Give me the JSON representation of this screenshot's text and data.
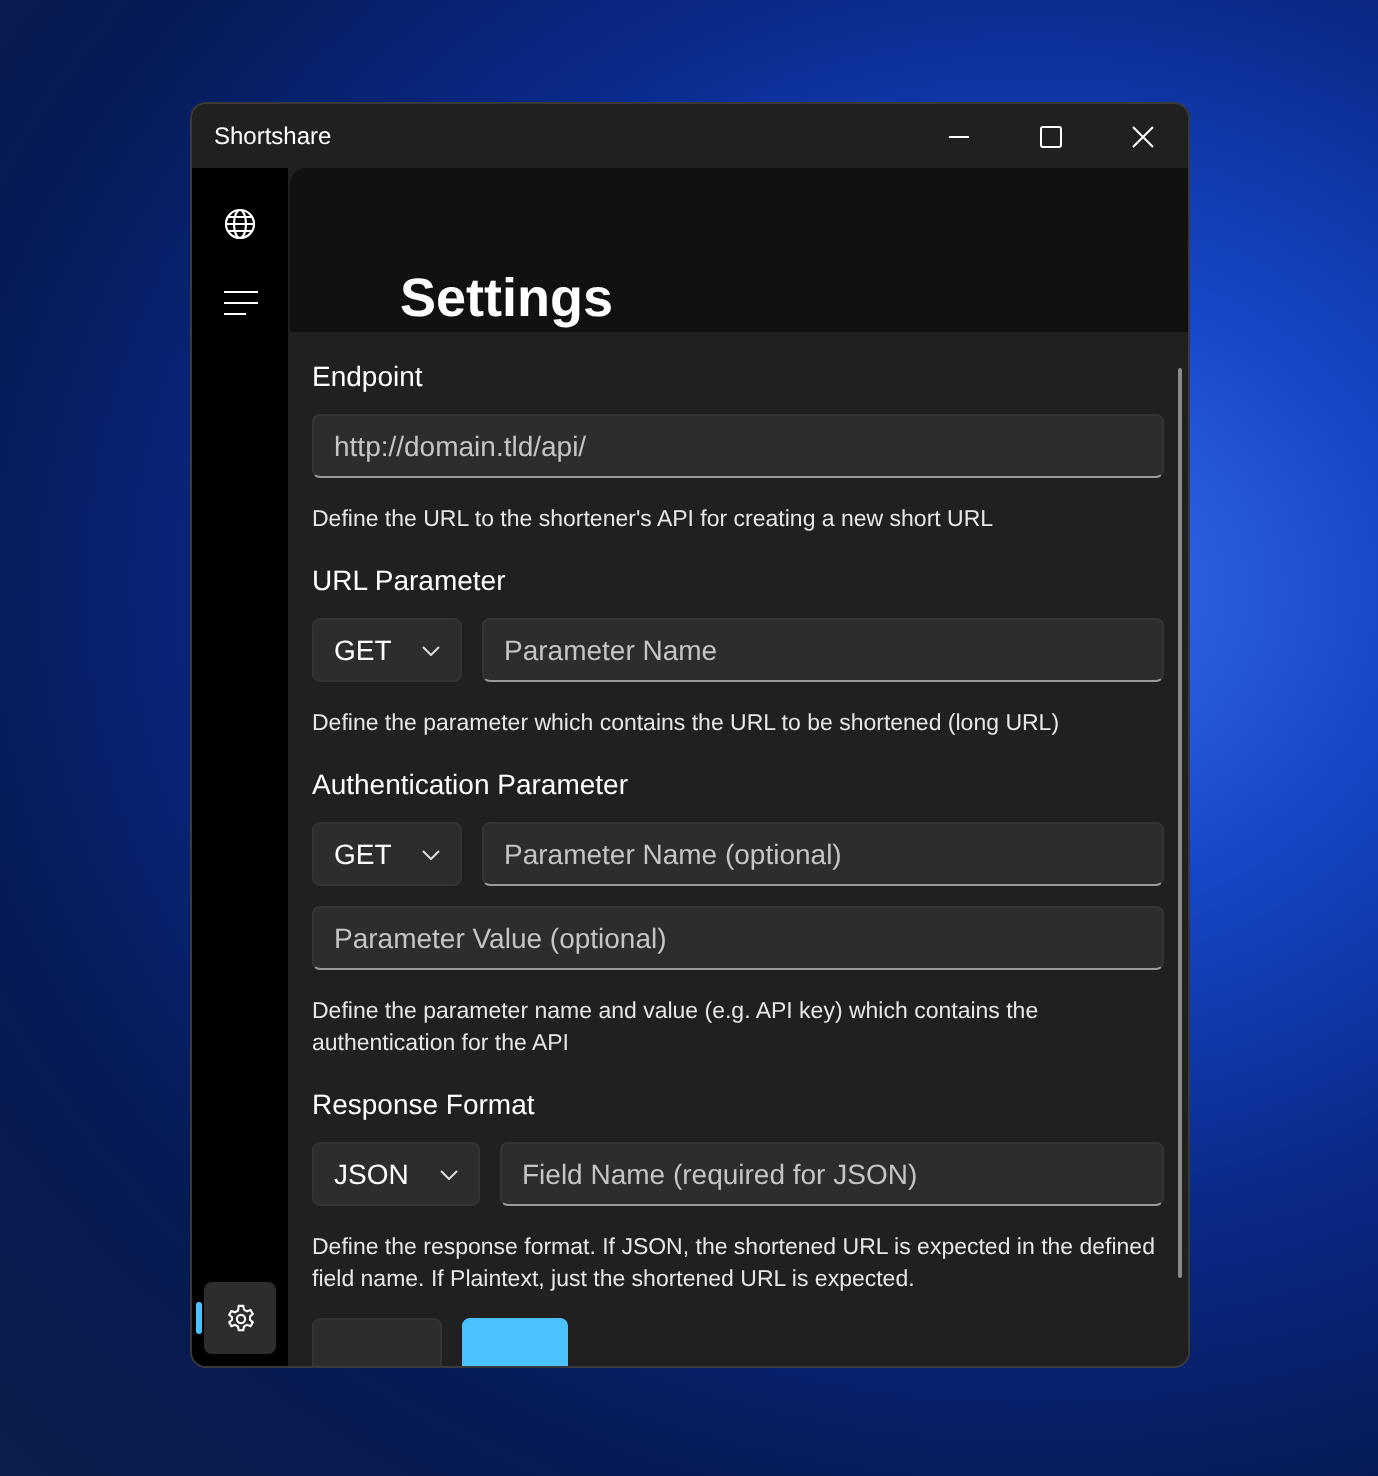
{
  "window": {
    "title": "Shortshare"
  },
  "sidebar": {
    "items": [
      {
        "selected": false
      }
    ],
    "footer_item": {
      "selected": true
    }
  },
  "page_title": "Settings",
  "sections": [
    {
      "label": "Endpoint",
      "rows": [
        [
          {
            "kind": "field",
            "placeholder": "http://domain.tld/api/"
          }
        ]
      ],
      "hint": "Define the URL to the shortener's API for creating a new short URL"
    },
    {
      "label": "URL Parameter",
      "rows": [
        [
          {
            "kind": "dropdown",
            "value": "GET"
          },
          {
            "kind": "field",
            "placeholder": "Parameter Name"
          }
        ]
      ],
      "hint": "Define the parameter which contains the URL to be shortened (long URL)"
    },
    {
      "label": "Authentication Parameter",
      "rows": [
        [
          {
            "kind": "dropdown",
            "value": "GET"
          },
          {
            "kind": "field",
            "placeholder": "Parameter Name (optional)"
          }
        ],
        [
          {
            "kind": "field",
            "placeholder": "Parameter Value (optional)"
          }
        ]
      ],
      "hint": "Define the parameter name and value (e.g. API key) which contains the authentication for the API"
    },
    {
      "label": "Response Format",
      "rows": [
        [
          {
            "kind": "dropdown",
            "value": "JSON"
          },
          {
            "kind": "field",
            "placeholder": "Field Name (required for JSON)"
          }
        ]
      ],
      "hint": "Define the response format. If JSON, the shortened URL is expected in the defined field name. If Plaintext, just the shortened URL is expected."
    }
  ],
  "buttons": [
    {
      "kind": "secondary"
    },
    {
      "kind": "primary"
    }
  ]
}
